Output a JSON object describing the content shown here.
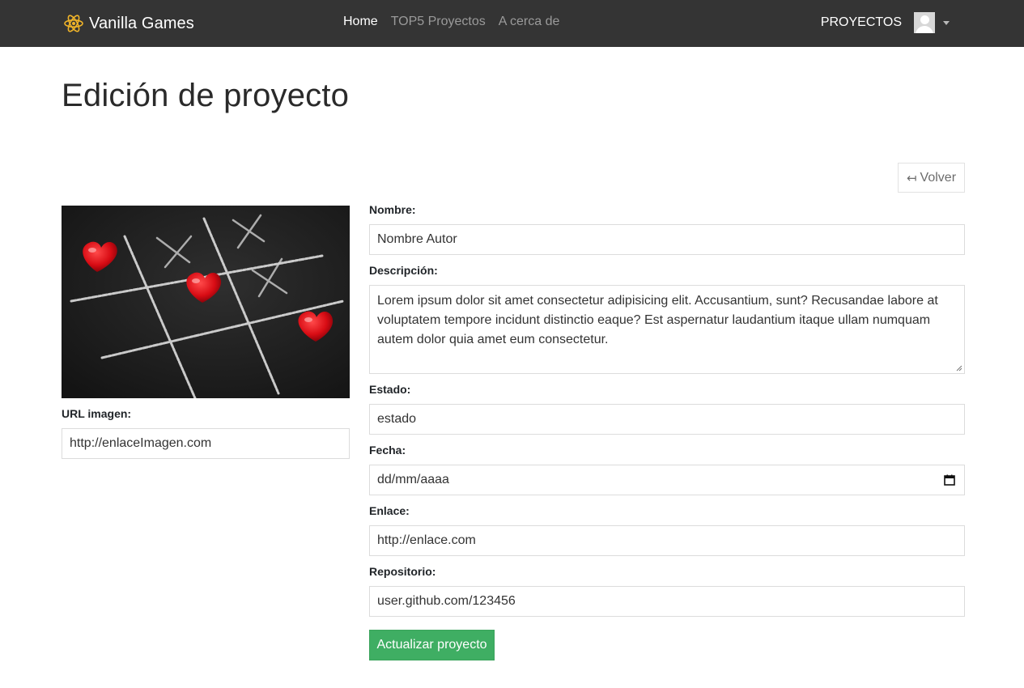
{
  "navbar": {
    "brand": "Vanilla Games",
    "links": [
      "Home",
      "TOP5 Proyectos",
      "A cerca de"
    ],
    "right_label": "PROYECTOS"
  },
  "page": {
    "title": "Edición de proyecto",
    "back_label": "Volver",
    "back_icon": "↤"
  },
  "form": {
    "image_url_label": "URL imagen:",
    "image_url_value": "http://enlaceImagen.com",
    "nombre_label": "Nombre:",
    "nombre_value": "Nombre Autor",
    "descripcion_label": "Descripción:",
    "descripcion_value": "Lorem ipsum dolor sit amet consectetur adipisicing elit. Accusantium, sunt? Recusandae labore at voluptatem tempore incidunt distinctio eaque? Est aspernatur laudantium itaque ullam numquam autem dolor quia amet eum consectetur.",
    "estado_label": "Estado:",
    "estado_value": "estado",
    "fecha_label": "Fecha:",
    "fecha_placeholder": "dd/mm/aaaa",
    "enlace_label": "Enlace:",
    "enlace_value": "http://enlace.com",
    "repositorio_label": "Repositorio:",
    "repositorio_value": "user.github.com/123456",
    "submit_label": "Actualizar proyecto"
  },
  "colors": {
    "navbar_bg": "#343434",
    "brand_icon": "#f0b429",
    "submit_bg": "#3fae63"
  },
  "icons": {
    "brand": "atom-icon",
    "avatar": "user-avatar-icon",
    "back": "back-arrow-icon",
    "calendar": "calendar-icon"
  }
}
